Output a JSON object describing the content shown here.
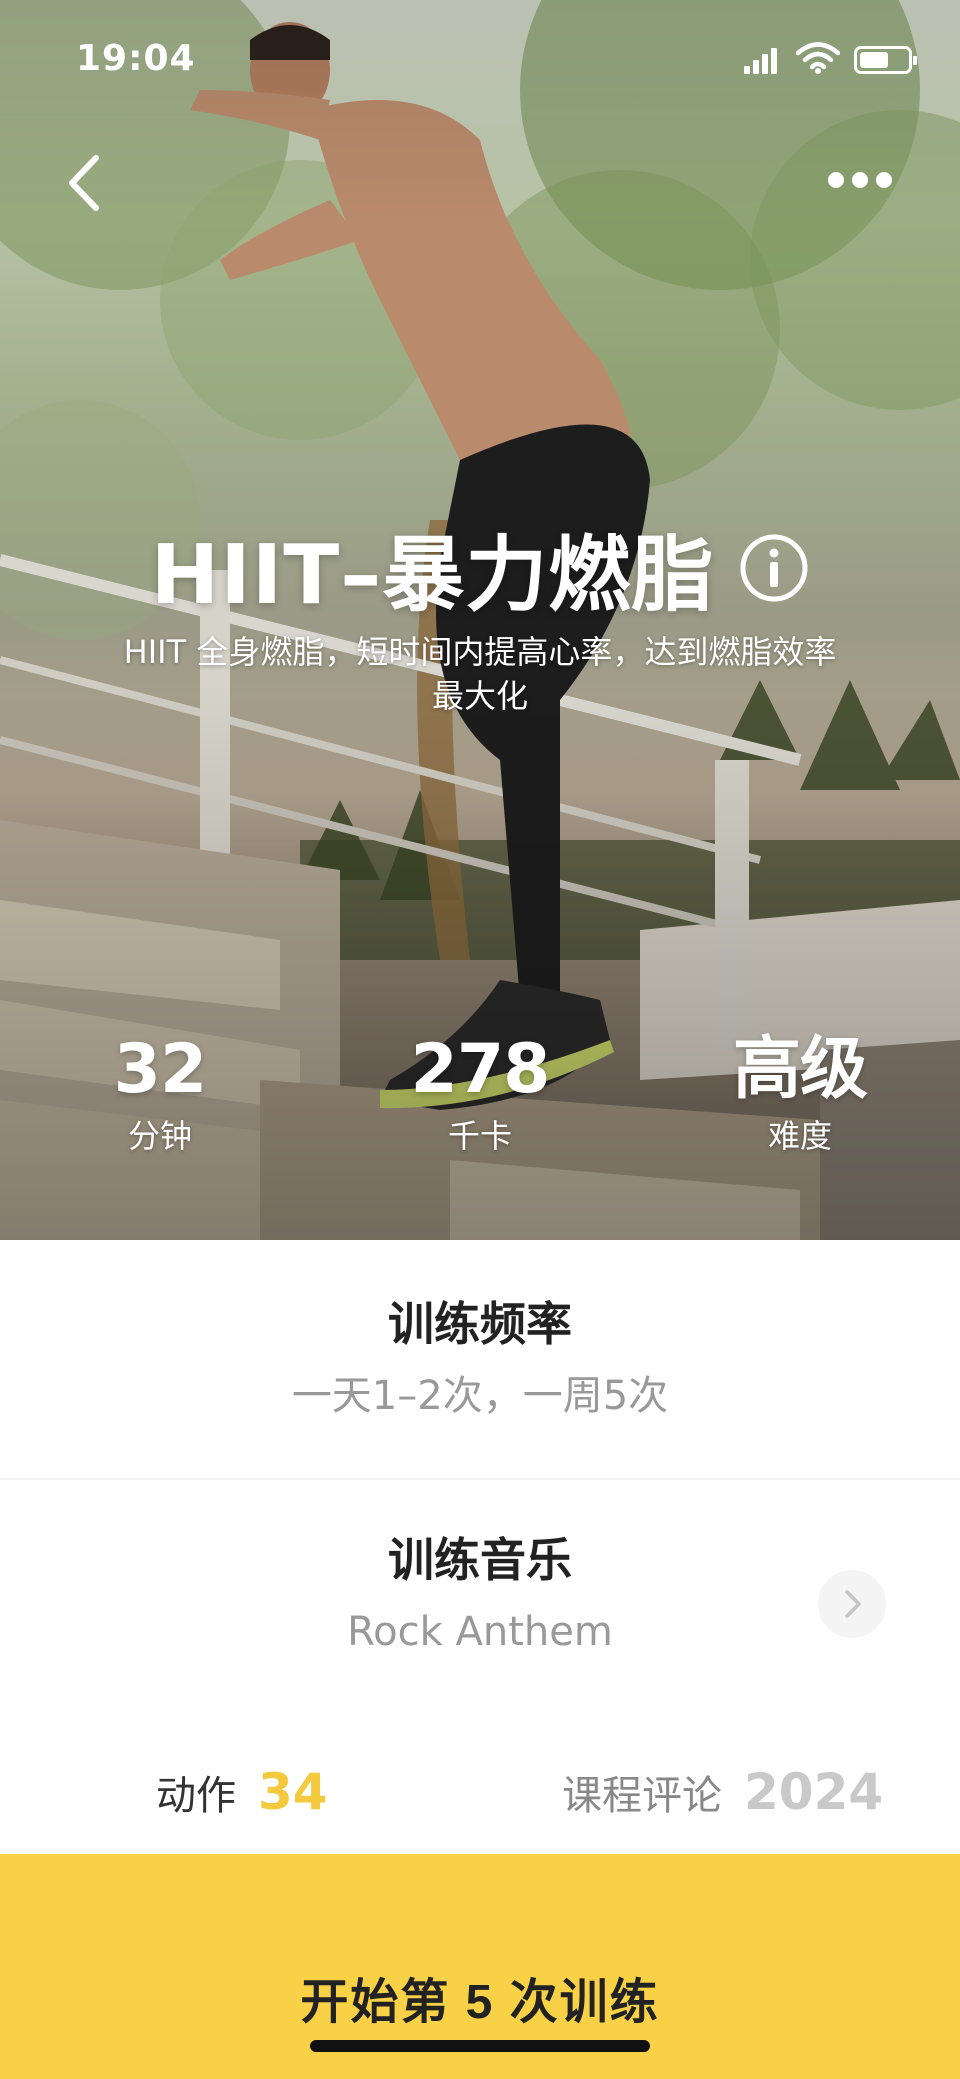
{
  "status_bar": {
    "time": "19:04"
  },
  "course": {
    "title": "HIIT–暴力燃脂",
    "description": "HIIT 全身燃脂，短时间内提高心率，达到燃脂效率最大化"
  },
  "stats": [
    {
      "value": "32",
      "label": "分钟"
    },
    {
      "value": "278",
      "label": "千卡"
    },
    {
      "value": "高级",
      "label": "难度"
    }
  ],
  "frequency": {
    "title": "训练频率",
    "value": "一天1–2次，一周5次"
  },
  "music": {
    "title": "训练音乐",
    "value": "Rock Anthem"
  },
  "counts": {
    "exercises_label": "动作",
    "exercises_value": "34",
    "comments_label": "课程评论",
    "comments_value": "2024"
  },
  "start_button": {
    "label": "开始第 5 次训练"
  },
  "colors": {
    "accent": "#f8d146",
    "count_highlight": "#f5c93d",
    "muted": "#999999"
  },
  "icons": [
    "back-arrow-icon",
    "more-icon",
    "info-icon",
    "chevron-right-icon",
    "signal-icon",
    "wifi-icon",
    "battery-icon"
  ]
}
